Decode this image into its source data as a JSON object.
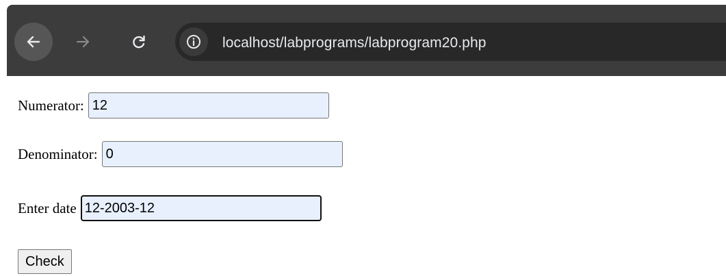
{
  "browser": {
    "back_icon": "arrow-left-icon",
    "forward_icon": "arrow-right-icon",
    "reload_icon": "reload-icon",
    "site_info_icon": "info-icon",
    "url": "localhost/labprograms/labprogram20.php"
  },
  "form": {
    "numerator": {
      "label": "Numerator:",
      "value": "12"
    },
    "denominator": {
      "label": "Denominator:",
      "value": "0"
    },
    "date": {
      "label": "Enter date",
      "value": "12-2003-12"
    },
    "submit_label": "Check"
  },
  "colors": {
    "toolbar": "#3c3c3c",
    "address_bar": "#282828",
    "input_autofill": "#e8f0fe",
    "button": "#efefef"
  }
}
